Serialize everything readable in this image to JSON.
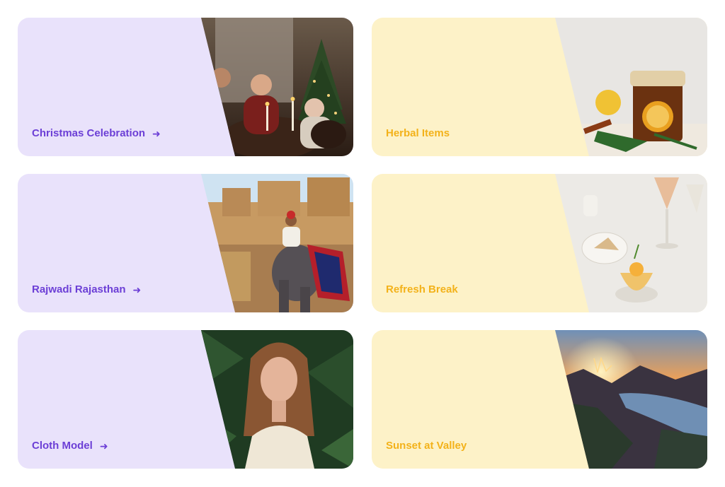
{
  "cards": [
    {
      "title": "Christmas Celebration",
      "theme": "purple",
      "has_arrow": true,
      "icon": "arrow-right-icon",
      "image": "christmas-dinner-photo"
    },
    {
      "title": "Herbal Items",
      "theme": "yellow",
      "has_arrow": false,
      "image": "herbal-tea-jar-photo"
    },
    {
      "title": "Rajwadi Rajasthan",
      "theme": "purple",
      "has_arrow": true,
      "icon": "arrow-right-icon",
      "image": "fort-elephant-photo"
    },
    {
      "title": "Refresh Break",
      "theme": "yellow",
      "has_arrow": false,
      "image": "dessert-wine-photo"
    },
    {
      "title": "Cloth Model",
      "theme": "purple",
      "has_arrow": true,
      "icon": "arrow-right-icon",
      "image": "woman-in-foliage-photo"
    },
    {
      "title": "Sunset at Valley",
      "theme": "yellow",
      "has_arrow": false,
      "image": "mountain-sunset-photo"
    }
  ],
  "arrow_glyph": "➜",
  "colors": {
    "purple_bg": "#e9e2fb",
    "purple_text": "#6c3fd6",
    "yellow_bg": "#fdf2c8",
    "yellow_text": "#f3b21a"
  }
}
